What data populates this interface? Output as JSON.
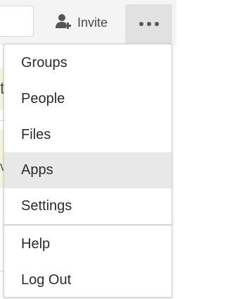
{
  "topbar": {
    "invite_label": "Invite",
    "invite_icon": "add-user-icon",
    "more_icon": "more-horizontal-icon"
  },
  "background": {
    "letter_1": "t",
    "letter_2": "v"
  },
  "menu": {
    "items": [
      {
        "label": "Groups"
      },
      {
        "label": "People"
      },
      {
        "label": "Files"
      },
      {
        "label": "Apps",
        "highlighted": true
      },
      {
        "label": "Settings"
      },
      {
        "label": "Help"
      },
      {
        "label": "Log Out"
      }
    ]
  },
  "colors": {
    "topbar_bg": "#f4f4f4",
    "more_button_bg": "#e1e1e1",
    "highlight_bg": "#e8e8e8",
    "text": "#2b2b2b"
  }
}
